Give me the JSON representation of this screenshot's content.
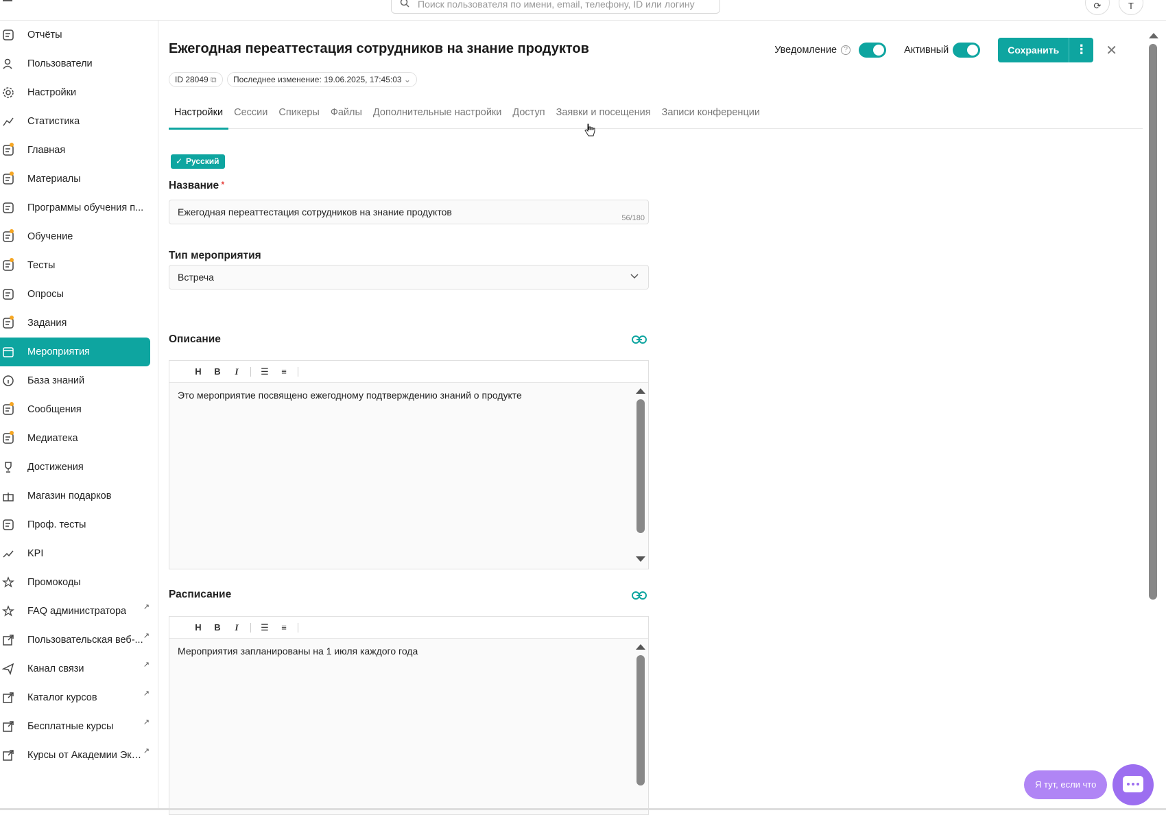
{
  "search": {
    "placeholder": "Поиск пользователя по имени, email, телефону, ID или логину"
  },
  "user_initial": "Т",
  "sidebar": {
    "items": [
      {
        "label": "Отчёты",
        "icon": "reports-icon",
        "dot": false,
        "ext": false
      },
      {
        "label": "Пользователи",
        "icon": "users-icon",
        "dot": false,
        "ext": false
      },
      {
        "label": "Настройки",
        "icon": "gear-icon",
        "dot": false,
        "ext": false
      },
      {
        "label": "Статистика",
        "icon": "chart-icon",
        "dot": false,
        "ext": false
      },
      {
        "label": "Главная",
        "icon": "home-icon",
        "dot": true,
        "ext": false
      },
      {
        "label": "Материалы",
        "icon": "materials-icon",
        "dot": true,
        "ext": false
      },
      {
        "label": "Программы обучения п...",
        "icon": "programs-icon",
        "dot": false,
        "ext": false
      },
      {
        "label": "Обучение",
        "icon": "learning-icon",
        "dot": true,
        "ext": false
      },
      {
        "label": "Тесты",
        "icon": "tests-icon",
        "dot": true,
        "ext": false
      },
      {
        "label": "Опросы",
        "icon": "polls-icon",
        "dot": false,
        "ext": false
      },
      {
        "label": "Задания",
        "icon": "tasks-icon",
        "dot": true,
        "ext": false
      },
      {
        "label": "Мероприятия",
        "icon": "calendar-icon",
        "dot": false,
        "ext": false,
        "active": true
      },
      {
        "label": "База знаний",
        "icon": "info-icon",
        "dot": false,
        "ext": false
      },
      {
        "label": "Сообщения",
        "icon": "messages-icon",
        "dot": true,
        "ext": false
      },
      {
        "label": "Медиатека",
        "icon": "media-icon",
        "dot": true,
        "ext": false
      },
      {
        "label": "Достижения",
        "icon": "trophy-icon",
        "dot": false,
        "ext": false
      },
      {
        "label": "Магазин подарков",
        "icon": "gift-icon",
        "dot": false,
        "ext": false
      },
      {
        "label": "Проф. тесты",
        "icon": "prof-tests-icon",
        "dot": false,
        "ext": false
      },
      {
        "label": "KPI",
        "icon": "trend-icon",
        "dot": false,
        "ext": false
      },
      {
        "label": "Промокоды",
        "icon": "star-icon",
        "dot": false,
        "ext": false
      },
      {
        "label": "FAQ администратора",
        "icon": "star-icon",
        "dot": false,
        "ext": true
      },
      {
        "label": "Пользовательская веб-...",
        "icon": "external-link-icon",
        "dot": false,
        "ext": true
      },
      {
        "label": "Канал связи",
        "icon": "send-icon",
        "dot": false,
        "ext": true
      },
      {
        "label": "Каталог курсов",
        "icon": "external-link-icon",
        "dot": false,
        "ext": true
      },
      {
        "label": "Бесплатные курсы",
        "icon": "external-link-icon",
        "dot": false,
        "ext": true
      },
      {
        "label": "Курсы от Академии Экв...",
        "icon": "external-link-icon",
        "dot": false,
        "ext": true
      }
    ]
  },
  "header": {
    "title": "Ежегодная переаттестация сотрудников на знание продуктов",
    "id_label": "ID 28049",
    "last_change": "Последнее изменение: 19.06.2025, 17:45:03",
    "notification_label": "Уведомление",
    "notification_on": true,
    "active_label": "Активный",
    "active_on": true,
    "save_label": "Сохранить"
  },
  "tabs": [
    {
      "label": "Настройки",
      "active": true
    },
    {
      "label": "Сессии"
    },
    {
      "label": "Спикеры"
    },
    {
      "label": "Файлы"
    },
    {
      "label": "Дополнительные настройки"
    },
    {
      "label": "Доступ"
    },
    {
      "label": "Заявки и посещения"
    },
    {
      "label": "Записи конференции"
    }
  ],
  "form": {
    "language": "Русский",
    "name_label": "Название",
    "name_value": "Ежегодная переаттестация сотрудников на знание продуктов",
    "name_counter": "56/180",
    "type_label": "Тип мероприятия",
    "type_value": "Встреча",
    "description_label": "Описание",
    "description_text": "Это мероприятие посвящено ежегодному подтверждению знаний о продукте",
    "schedule_label": "Расписание",
    "schedule_text": "Мероприятия запланированы на 1 июля каждого года",
    "toolbar": {
      "heading": "H",
      "bold": "B",
      "italic": "I"
    }
  },
  "chat": {
    "pill_label": "Я тут, если что"
  },
  "colors": {
    "accent": "#0ea5a0",
    "chat": "#9c6ef0"
  }
}
